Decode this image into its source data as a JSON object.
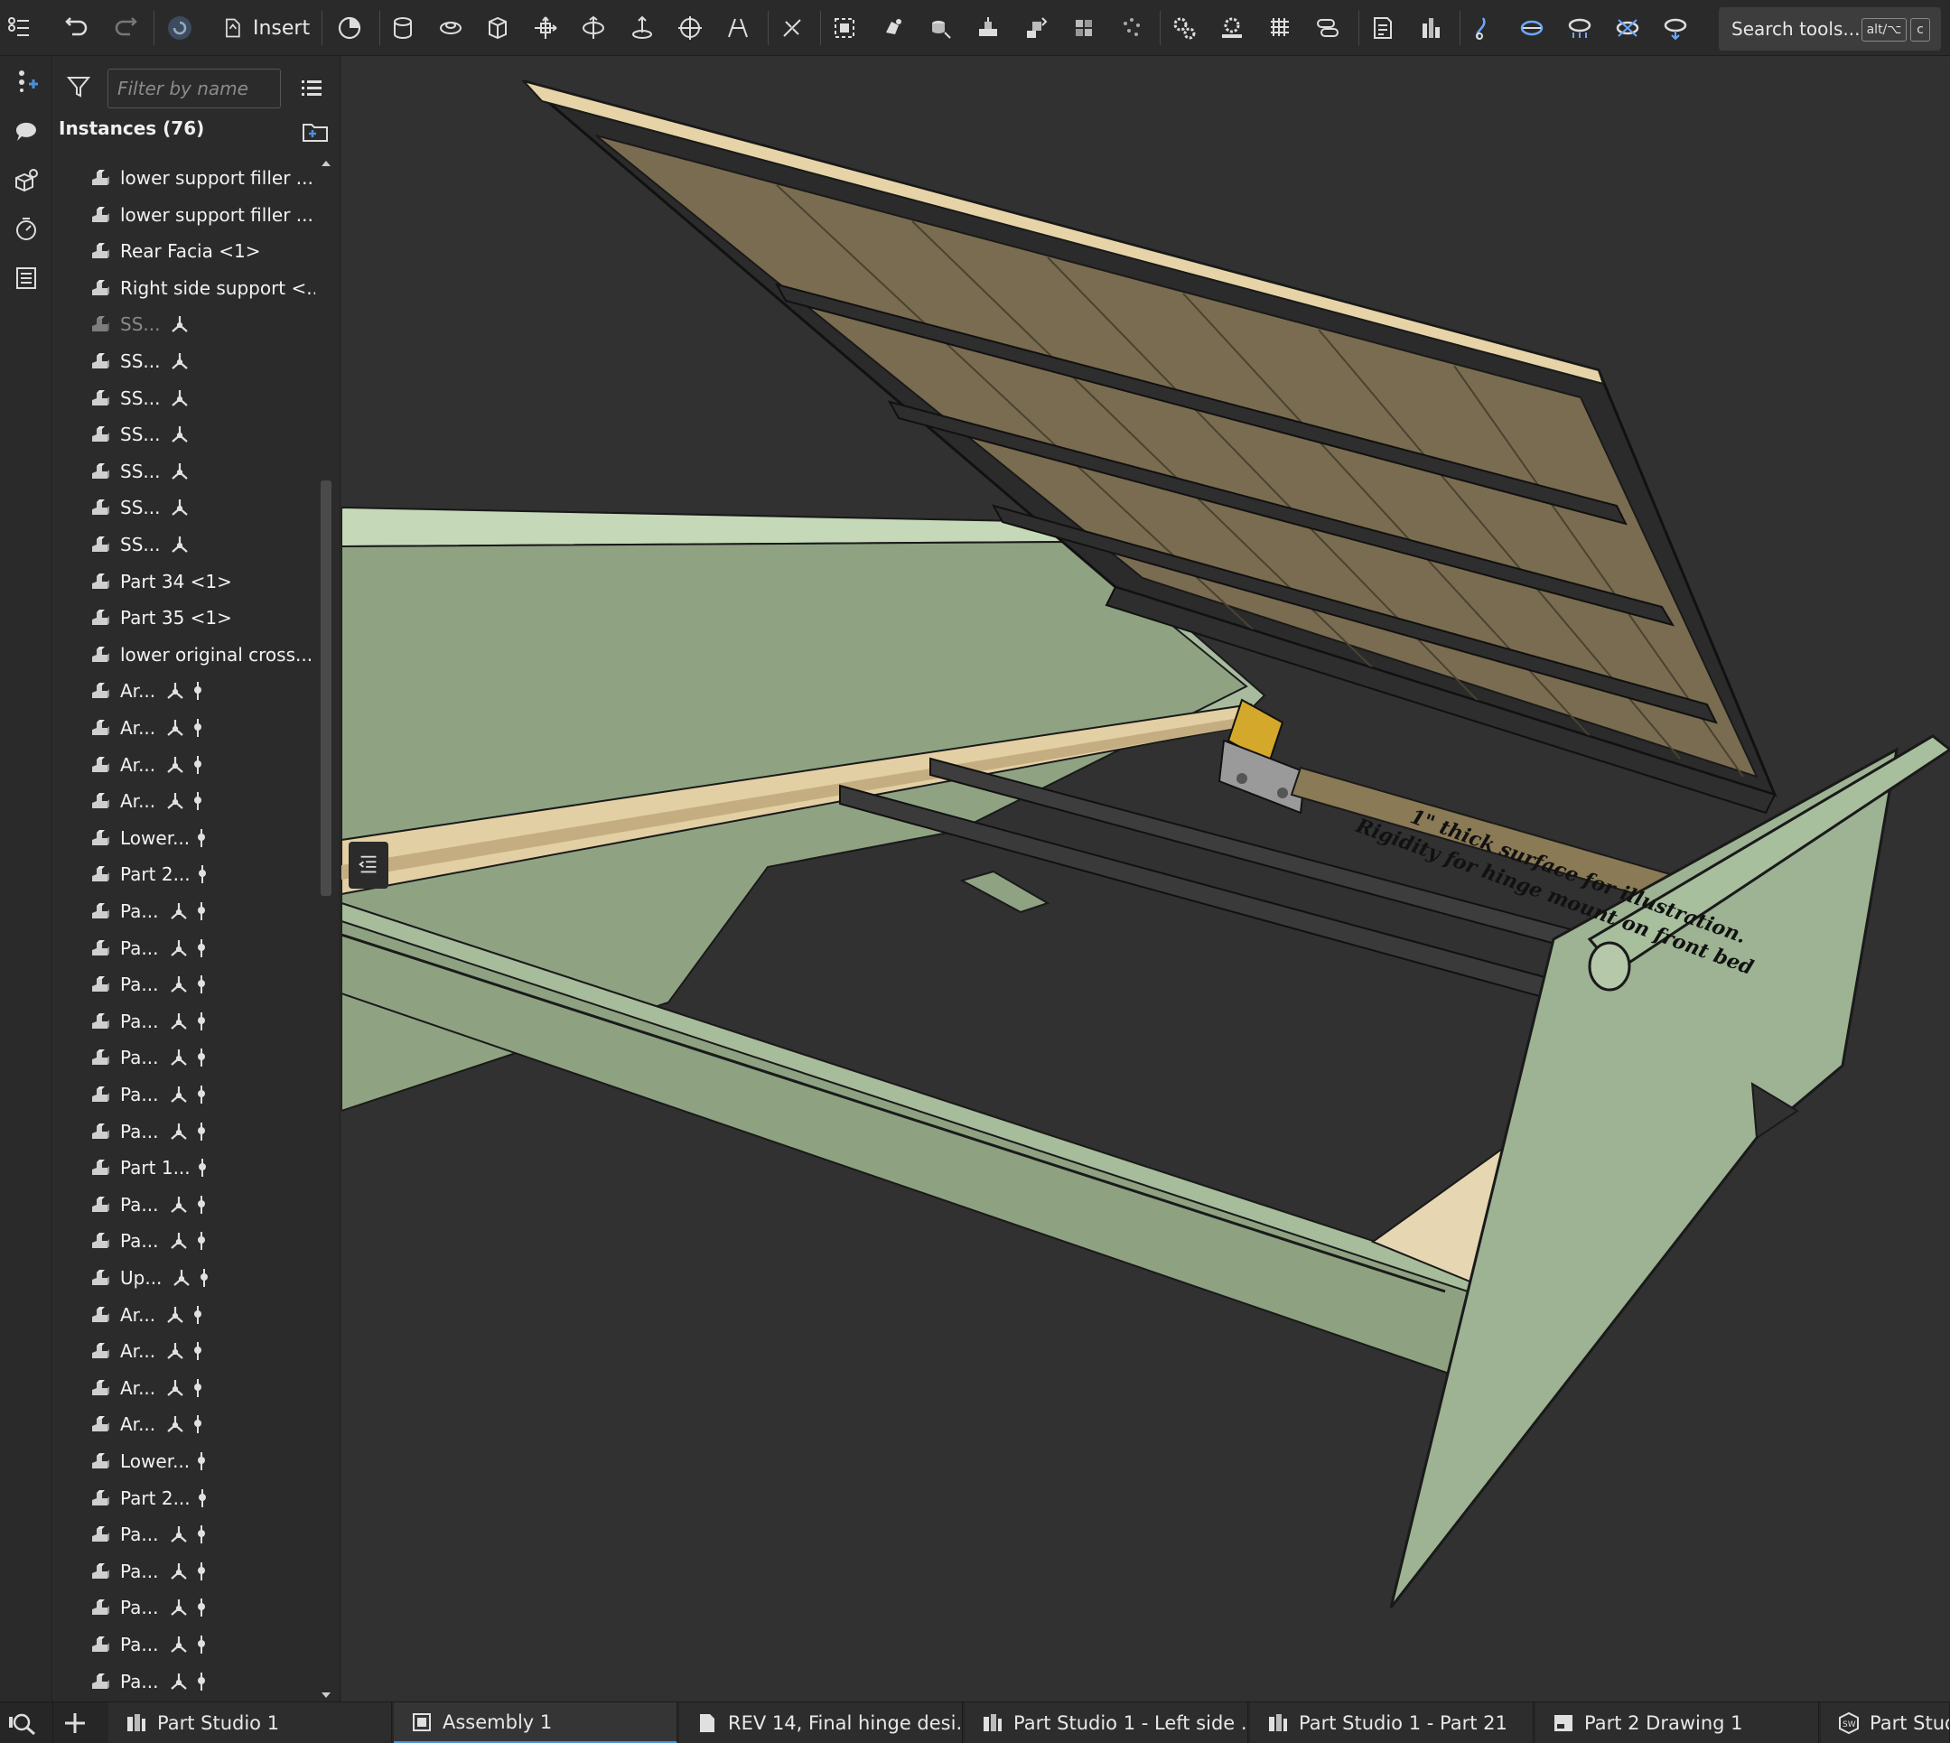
{
  "toolbar": {
    "insert_label": "Insert",
    "search_label": "Search tools...",
    "shortcut_alt": "alt/⌥",
    "shortcut_c": "c"
  },
  "panel": {
    "filter_placeholder": "Filter by name",
    "instances_label": "Instances (76)"
  },
  "instances": [
    {
      "label": "lower support filler ...",
      "mate": false,
      "pin": false,
      "dim": false
    },
    {
      "label": "lower support filler ...",
      "mate": false,
      "pin": false,
      "dim": false
    },
    {
      "label": "Rear Facia <1>",
      "mate": false,
      "pin": false,
      "dim": false
    },
    {
      "label": "Right side support <...",
      "mate": false,
      "pin": false,
      "dim": false
    },
    {
      "label": "SS...",
      "mate": true,
      "pin": false,
      "dim": true
    },
    {
      "label": "SS...",
      "mate": true,
      "pin": false,
      "dim": false
    },
    {
      "label": "SS...",
      "mate": true,
      "pin": false,
      "dim": false
    },
    {
      "label": "SS...",
      "mate": true,
      "pin": false,
      "dim": false
    },
    {
      "label": "SS...",
      "mate": true,
      "pin": false,
      "dim": false
    },
    {
      "label": "SS...",
      "mate": true,
      "pin": false,
      "dim": false
    },
    {
      "label": "SS...",
      "mate": true,
      "pin": false,
      "dim": false
    },
    {
      "label": "Part 34 <1>",
      "mate": false,
      "pin": false,
      "dim": false
    },
    {
      "label": "Part 35 <1>",
      "mate": false,
      "pin": false,
      "dim": false
    },
    {
      "label": "lower original cross...",
      "mate": false,
      "pin": false,
      "dim": false
    },
    {
      "label": "Ar...",
      "mate": true,
      "pin": true,
      "dim": false
    },
    {
      "label": "Ar...",
      "mate": true,
      "pin": true,
      "dim": false
    },
    {
      "label": "Ar...",
      "mate": true,
      "pin": true,
      "dim": false
    },
    {
      "label": "Ar...",
      "mate": true,
      "pin": true,
      "dim": false
    },
    {
      "label": "Lower...",
      "mate": false,
      "pin": true,
      "dim": false
    },
    {
      "label": "Part 2...",
      "mate": false,
      "pin": true,
      "dim": false
    },
    {
      "label": "Pa...",
      "mate": true,
      "pin": true,
      "dim": false
    },
    {
      "label": "Pa...",
      "mate": true,
      "pin": true,
      "dim": false
    },
    {
      "label": "Pa...",
      "mate": true,
      "pin": true,
      "dim": false
    },
    {
      "label": "Pa...",
      "mate": true,
      "pin": true,
      "dim": false
    },
    {
      "label": "Pa...",
      "mate": true,
      "pin": true,
      "dim": false
    },
    {
      "label": "Pa...",
      "mate": true,
      "pin": true,
      "dim": false
    },
    {
      "label": "Pa...",
      "mate": true,
      "pin": true,
      "dim": false
    },
    {
      "label": "Part 1...",
      "mate": false,
      "pin": true,
      "dim": false
    },
    {
      "label": "Pa...",
      "mate": true,
      "pin": true,
      "dim": false
    },
    {
      "label": "Pa...",
      "mate": true,
      "pin": true,
      "dim": false
    },
    {
      "label": "Up...",
      "mate": true,
      "pin": true,
      "dim": false
    },
    {
      "label": "Ar...",
      "mate": true,
      "pin": true,
      "dim": false
    },
    {
      "label": "Ar...",
      "mate": true,
      "pin": true,
      "dim": false
    },
    {
      "label": "Ar...",
      "mate": true,
      "pin": true,
      "dim": false
    },
    {
      "label": "Ar...",
      "mate": true,
      "pin": true,
      "dim": false
    },
    {
      "label": "Lower...",
      "mate": false,
      "pin": true,
      "dim": false
    },
    {
      "label": "Part 2...",
      "mate": false,
      "pin": true,
      "dim": false
    },
    {
      "label": "Pa...",
      "mate": true,
      "pin": true,
      "dim": false
    },
    {
      "label": "Pa...",
      "mate": true,
      "pin": true,
      "dim": false
    },
    {
      "label": "Pa...",
      "mate": true,
      "pin": true,
      "dim": false
    },
    {
      "label": "Pa...",
      "mate": true,
      "pin": true,
      "dim": false
    },
    {
      "label": "Pa...",
      "mate": true,
      "pin": true,
      "dim": false
    }
  ],
  "viewport": {
    "annotation_line1": "1\" thick surface for illustration.",
    "annotation_line2": "Rigidity for hinge mount on front bed"
  },
  "tabs": [
    {
      "label": "Part Studio 1",
      "icon": "part-studio-icon",
      "active": false
    },
    {
      "label": "Assembly 1",
      "icon": "assembly-icon",
      "active": true
    },
    {
      "label": "REV 14, Final hinge desi...",
      "icon": "document-icon",
      "active": false
    },
    {
      "label": "Part Studio 1 - Left side ...",
      "icon": "part-studio-icon",
      "active": false
    },
    {
      "label": "Part Studio 1 - Part 21",
      "icon": "part-studio-icon",
      "active": false
    },
    {
      "label": "Part 2 Drawing 1",
      "icon": "drawing-icon",
      "active": false
    },
    {
      "label": "Part Studi",
      "icon": "solidworks-icon",
      "active": false
    }
  ],
  "colors": {
    "accent": "#4a90d9",
    "panel_bg": "#2b2b2b",
    "viewport_bg": "#313131",
    "bed_green": "#8fa383",
    "wood": "#d9c7a0",
    "lid_panel": "#7a6c50",
    "hinge_yellow": "#d4a82a"
  }
}
